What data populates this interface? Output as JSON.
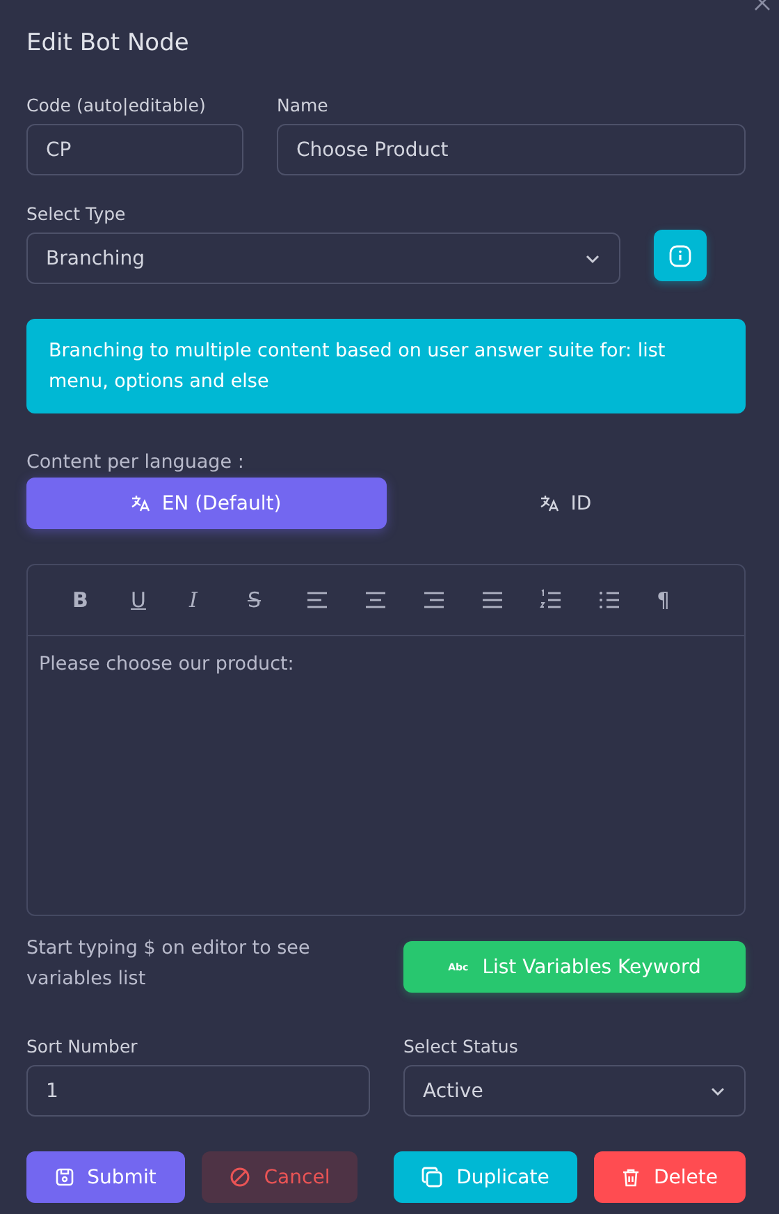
{
  "dialog": {
    "title": "Edit Bot Node"
  },
  "code": {
    "label": "Code (auto|editable)",
    "value": "CP"
  },
  "name": {
    "label": "Name",
    "value": "Choose Product"
  },
  "select_type": {
    "label": "Select Type",
    "value": "Branching"
  },
  "info_alert": "Branching to multiple content based on user answer suite for: list menu, options and else",
  "content_label": "Content per language :",
  "language_tabs": [
    {
      "label": "EN (Default)",
      "selected": true
    },
    {
      "label": "ID",
      "selected": false
    }
  ],
  "toolbar": [
    {
      "kind": "bold",
      "text": "B"
    },
    {
      "kind": "underline",
      "text": "U"
    },
    {
      "kind": "italic",
      "text": "I"
    },
    {
      "kind": "strike",
      "text": "S"
    },
    {
      "kind": "align-left"
    },
    {
      "kind": "align-center"
    },
    {
      "kind": "align-right"
    },
    {
      "kind": "justify"
    },
    {
      "kind": "ordered-list"
    },
    {
      "kind": "bullet-list"
    },
    {
      "kind": "paragraph",
      "text": "¶"
    }
  ],
  "editor_text": "Please choose our product:",
  "hint": "Start typing $ on editor to see variables list",
  "variables_button": {
    "icon_text": "Abc",
    "label": "List Variables Keyword"
  },
  "sort_number": {
    "label": "Sort Number",
    "value": "1"
  },
  "select_status": {
    "label": "Select Status",
    "value": "Active"
  },
  "actions": [
    {
      "kind": "submit",
      "label": "Submit"
    },
    {
      "kind": "cancel",
      "label": "Cancel"
    },
    {
      "kind": "duplicate",
      "label": "Duplicate"
    },
    {
      "kind": "delete",
      "label": "Delete"
    }
  ]
}
